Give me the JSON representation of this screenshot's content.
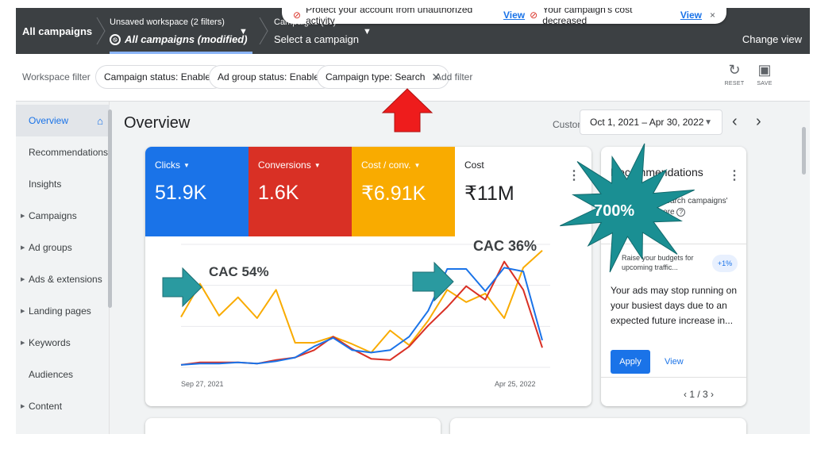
{
  "topbar": {
    "all_campaigns": "All campaigns",
    "workspace_label": "Unsaved workspace (2 filters)",
    "workspace_value": "All campaigns (modified)",
    "campaigns_label": "Campaigns (16)",
    "campaigns_value": "Select a campaign",
    "change_view": "Change view"
  },
  "notification": {
    "msg1": "Protect your account from unauthorized activity",
    "link1": "View",
    "msg2": "Your campaign's cost decreased",
    "link2": "View"
  },
  "filterbar": {
    "label": "Workspace filter",
    "chips": [
      "Campaign status: Enabled",
      "Ad group status: Enabled",
      "Campaign type: Search"
    ],
    "add_filter": "Add filter",
    "reset": "RESET",
    "save": "SAVE"
  },
  "sidebar": {
    "items": [
      {
        "label": "Overview"
      },
      {
        "label": "Recommendations"
      },
      {
        "label": "Insights"
      },
      {
        "label": "Campaigns"
      },
      {
        "label": "Ad groups"
      },
      {
        "label": "Ads & extensions"
      },
      {
        "label": "Landing pages"
      },
      {
        "label": "Keywords"
      },
      {
        "label": "Audiences"
      },
      {
        "label": "Content"
      }
    ]
  },
  "main": {
    "title": "Overview",
    "custom_label": "Custom",
    "date_range": "Oct 1, 2021 – Apr 30, 2022"
  },
  "metrics": [
    {
      "name": "Clicks",
      "value": "51.9K",
      "color": "#1a73e8"
    },
    {
      "name": "Conversions",
      "value": "1.6K",
      "color": "#d93025"
    },
    {
      "name": "Cost / conv.",
      "value": "₹6.91K",
      "color": "#f9ab00"
    },
    {
      "name": "Cost",
      "value": "₹11M",
      "color": "#ffffff"
    }
  ],
  "chart_data": {
    "type": "line",
    "x_labels": [
      "Sep 27, 2021",
      "Apr 25, 2022"
    ],
    "series": [
      {
        "name": "Clicks",
        "color": "#1a73e8",
        "values": [
          0.02,
          0.03,
          0.03,
          0.04,
          0.03,
          0.05,
          0.08,
          0.17,
          0.24,
          0.14,
          0.12,
          0.14,
          0.25,
          0.46,
          0.8,
          0.8,
          0.62,
          0.81,
          0.78,
          0.22
        ]
      },
      {
        "name": "Conversions",
        "color": "#d93025",
        "values": [
          0.02,
          0.04,
          0.04,
          0.04,
          0.03,
          0.06,
          0.08,
          0.14,
          0.25,
          0.15,
          0.07,
          0.06,
          0.17,
          0.34,
          0.49,
          0.66,
          0.55,
          0.86,
          0.63,
          0.16
        ]
      },
      {
        "name": "Cost / conv.",
        "color": "#f9ab00",
        "values": [
          0.41,
          0.68,
          0.42,
          0.57,
          0.4,
          0.63,
          0.2,
          0.2,
          0.25,
          0.19,
          0.12,
          0.3,
          0.18,
          0.38,
          0.63,
          0.53,
          0.6,
          0.4,
          0.81,
          0.95
        ]
      }
    ]
  },
  "recommendations": {
    "title": "Recommendations",
    "subtitle": "Optimize your search campaigns' optimization score",
    "budget_tip": "Raise your budgets for upcoming traffic...",
    "badge": "+1%",
    "description": "Your ads may stop running on your busiest days due to an expected future increase in...",
    "apply": "Apply",
    "view": "View",
    "pager": "1 / 3"
  },
  "annotations": {
    "cac_left": "CAC 54%",
    "cac_right": "CAC 36%",
    "burst": "700%"
  }
}
